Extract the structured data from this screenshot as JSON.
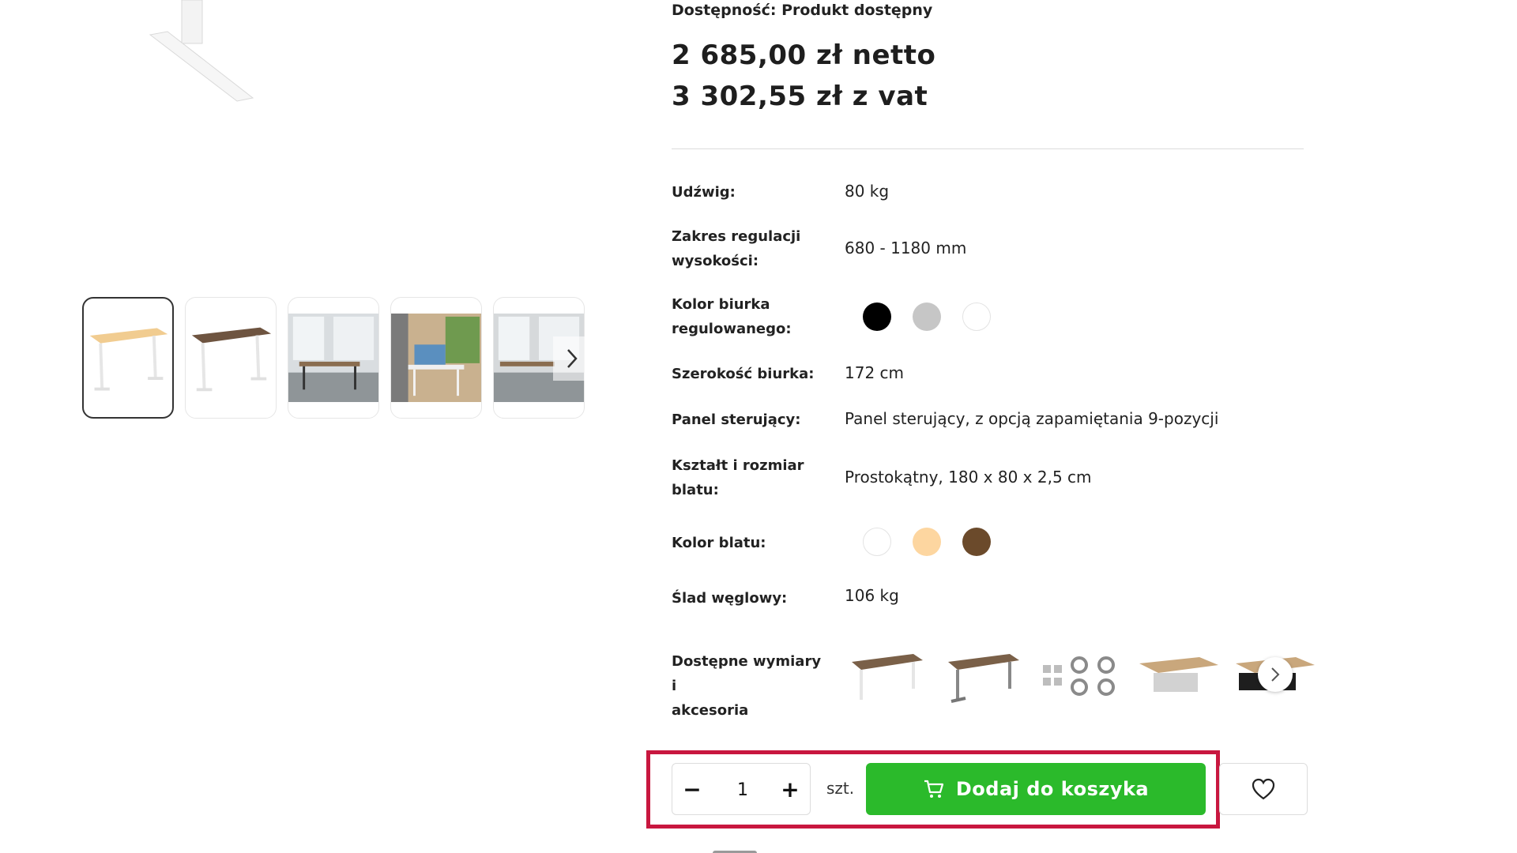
{
  "product": {
    "availability": "Dostępność: Produkt dostępny",
    "price_netto": "2 685,00 zł netto",
    "price_vat": "3 302,55 zł z vat"
  },
  "gallery": {
    "thumbnails": [
      {
        "name": "desk-light-top-white-frame"
      },
      {
        "name": "desk-walnut-top-white-frame"
      },
      {
        "name": "office-photo-dark-frame"
      },
      {
        "name": "office-photo-white-frame"
      },
      {
        "name": "office-photo-window"
      }
    ]
  },
  "specs": {
    "capacity_label": "Udźwig:",
    "capacity_value": "80 kg",
    "height_label_line1": "Zakres regulacji",
    "height_label_line2": "wysokości:",
    "height_value": "680 - 1180 mm",
    "frame_color_label_line1": "Kolor biurka",
    "frame_color_label_line2": "regulowanego:",
    "frame_colors": [
      "#000000",
      "#c6c6c6",
      "#ffffff"
    ],
    "width_label": "Szerokość biurka:",
    "width_value": "172 cm",
    "panel_label": "Panel sterujący:",
    "panel_value": "Panel sterujący, z opcją zapamiętania 9-pozycji",
    "shape_label_line1": "Kształt i rozmiar",
    "shape_label_line2": "blatu:",
    "shape_value": "Prostokątny, 180 x 80 x 2,5 cm",
    "top_color_label": "Kolor blatu:",
    "top_colors": [
      "#ffffff",
      "#fdd6a0",
      "#6b4a2b"
    ],
    "carbon_label": "Ślad węglowy:",
    "carbon_value": "106 kg",
    "accessories_label_line1": "Dostępne wymiary i",
    "accessories_label_line2": "akcesoria"
  },
  "cart": {
    "minus": "−",
    "plus": "+",
    "quantity": "1",
    "unit": "szt.",
    "add_label": "Dodaj do koszyka",
    "accent": "#2bba2b",
    "highlight": "#c8173f"
  }
}
